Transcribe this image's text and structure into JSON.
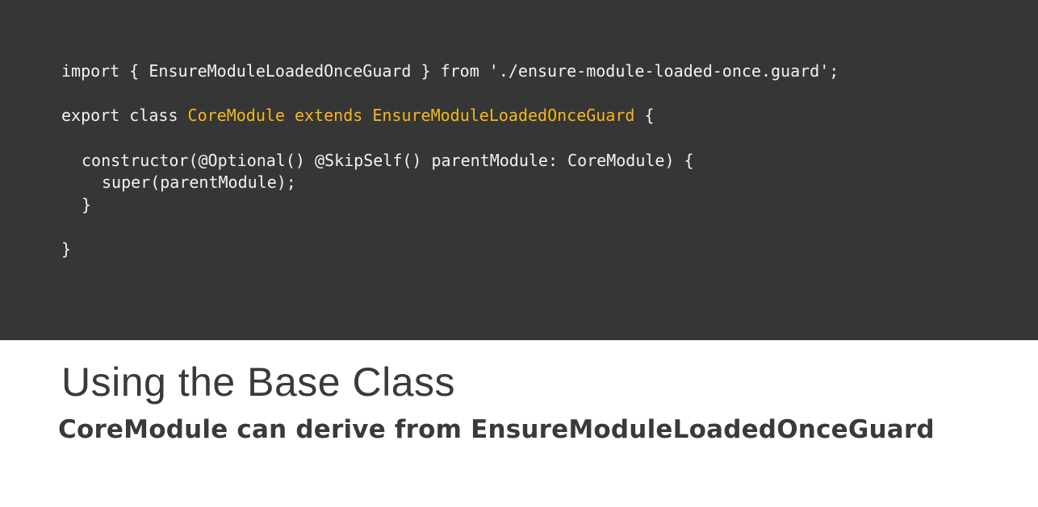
{
  "code": {
    "line1": {
      "text": "import { EnsureModuleLoadedOnceGuard } from './ensure-module-loaded-once.guard';"
    },
    "line2": {
      "prefix": "export class ",
      "class_name": "CoreModule",
      "keyword": " extends ",
      "base_class": "EnsureModuleLoadedOnceGuard",
      "suffix": " {"
    },
    "line3": {
      "text": "constructor(@Optional() @SkipSelf() parentModule: CoreModule) {"
    },
    "line4": {
      "text": "super(parentModule);"
    },
    "line5": {
      "text": "}"
    },
    "line6": {
      "text": "}"
    },
    "highlight_color": "#f6b71a",
    "background_color": "#363636"
  },
  "slide": {
    "title": "Using the Base Class",
    "subtitle": "CoreModule can derive from EnsureModuleLoadedOnceGuard"
  }
}
